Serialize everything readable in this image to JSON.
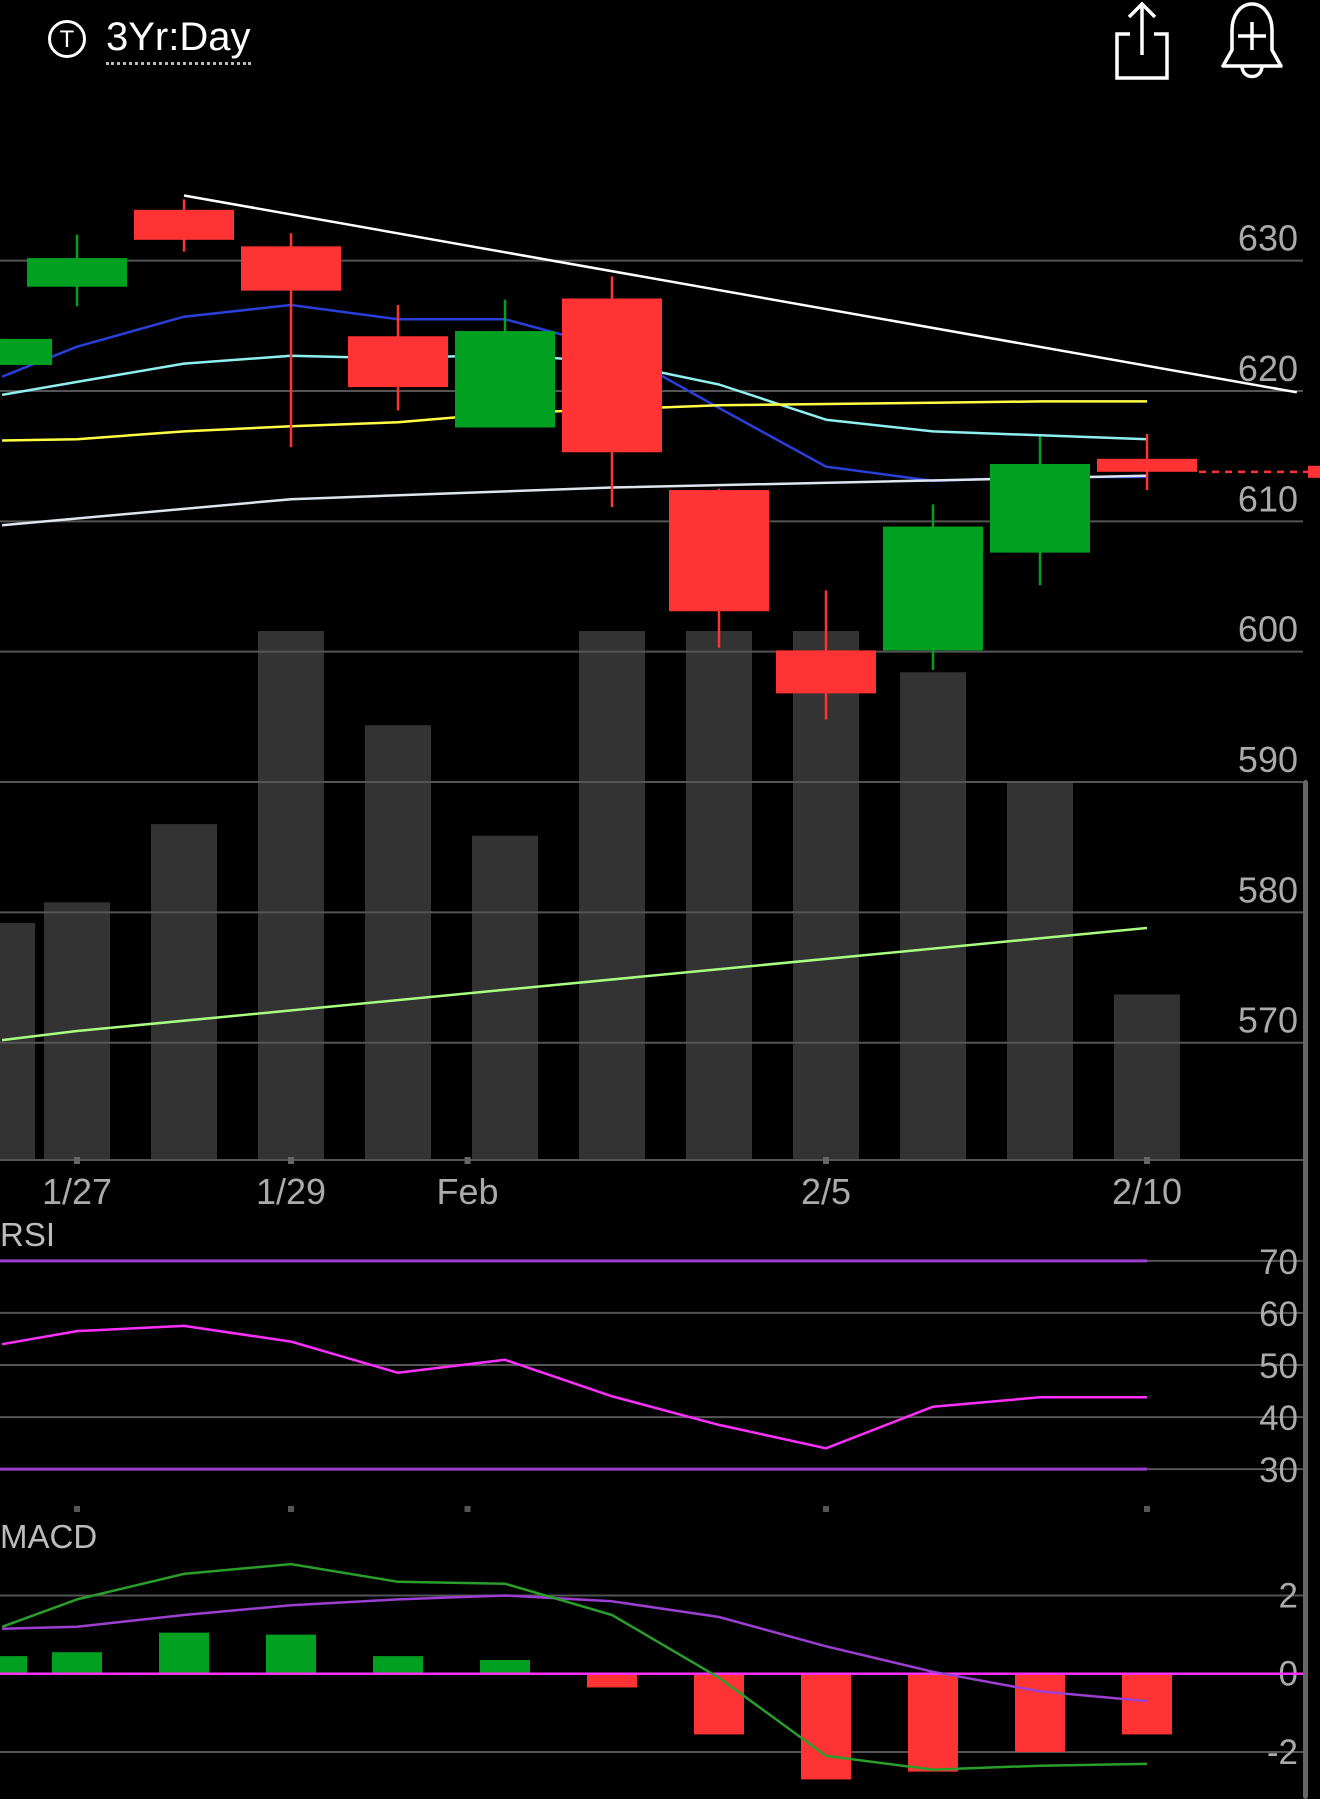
{
  "header": {
    "ticker_badge": "T",
    "range": "3Yr:Day",
    "share_icon": "share-icon",
    "alert_icon": "add-alert-bell-icon"
  },
  "colors": {
    "up": "#00a020",
    "down": "#ff3333",
    "bg": "#000000",
    "grid": "#555555",
    "ma_blue": "#2a3fd8",
    "ma_cyan": "#8ff0f0",
    "ma_yellow": "#ffff44",
    "ma_white": "#dde6f0",
    "ma_green": "#a8ff80",
    "rsi": "#ff30ff",
    "rsi_bounds": "#9a3fd0",
    "macd": "#2a9d2a",
    "signal": "#9a3fd0",
    "volume": "#333333",
    "trendline": "#ffffff"
  },
  "chart_data": [
    {
      "type": "candlestick",
      "ylim": [
        561,
        650
      ],
      "yticks": [
        570,
        580,
        590,
        600,
        610,
        620,
        630
      ],
      "x_labels": [
        {
          "index": 0,
          "text": "1/27"
        },
        {
          "index": 2,
          "text": "1/29"
        },
        {
          "index": 3.65,
          "text": "Feb"
        },
        {
          "index": 7,
          "text": "2/5"
        },
        {
          "index": 10,
          "text": "2/10"
        }
      ],
      "candles": [
        {
          "i": -0.7,
          "open": 622,
          "close": 624,
          "high": 624,
          "low": 622
        },
        {
          "i": 0,
          "open": 628,
          "close": 630.2,
          "high": 632,
          "low": 626.5
        },
        {
          "i": 1,
          "open": 633.9,
          "close": 631.6,
          "high": 634.7,
          "low": 630.7
        },
        {
          "i": 2,
          "open": 631.1,
          "close": 627.7,
          "high": 632.1,
          "low": 615.7
        },
        {
          "i": 3,
          "open": 624.2,
          "close": 620.3,
          "high": 626.6,
          "low": 618.5
        },
        {
          "i": 4,
          "open": 617.2,
          "close": 624.6,
          "high": 627,
          "low": 617.2
        },
        {
          "i": 5,
          "open": 627.1,
          "close": 615.3,
          "high": 628.8,
          "low": 611.1
        },
        {
          "i": 6,
          "open": 612.4,
          "close": 603.1,
          "high": 612.5,
          "low": 600.3
        },
        {
          "i": 7,
          "open": 600.1,
          "close": 596.8,
          "high": 604.7,
          "low": 594.8
        },
        {
          "i": 8,
          "open": 600.1,
          "close": 609.6,
          "high": 611.3,
          "low": 598.6
        },
        {
          "i": 9,
          "open": 607.6,
          "close": 614.4,
          "high": 616.5,
          "low": 605.1
        },
        {
          "i": 10,
          "open": 614.8,
          "close": 613.8,
          "high": 616.7,
          "low": 612.4
        }
      ],
      "last_price": 613.8,
      "volume": [
        {
          "i": -0.7,
          "h": 0.448
        },
        {
          "i": 0,
          "h": 0.487
        },
        {
          "i": 1,
          "h": 0.635
        },
        {
          "i": 2,
          "h": 1.0
        },
        {
          "i": 3,
          "h": 0.822
        },
        {
          "i": 4,
          "h": 0.613
        },
        {
          "i": 5,
          "h": 1.0
        },
        {
          "i": 6,
          "h": 1.0
        },
        {
          "i": 7,
          "h": 1.0
        },
        {
          "i": 8,
          "h": 0.922
        },
        {
          "i": 9,
          "h": 0.713
        },
        {
          "i": 10,
          "h": 0.313
        }
      ],
      "series": [
        {
          "color_key": "ma_blue",
          "values": [
            [
              -0.7,
              621.1
            ],
            [
              0,
              623.4
            ],
            [
              1,
              625.7
            ],
            [
              2,
              626.6
            ],
            [
              3,
              625.5
            ],
            [
              4,
              625.5
            ],
            [
              5,
              623.3
            ],
            [
              6,
              618.7
            ],
            [
              7,
              614.2
            ],
            [
              8,
              613.1
            ],
            [
              9,
              613.4
            ],
            [
              10,
              613.4
            ]
          ]
        },
        {
          "color_key": "ma_cyan",
          "values": [
            [
              -0.7,
              619.7
            ],
            [
              0,
              620.7
            ],
            [
              1,
              622.1
            ],
            [
              2,
              622.7
            ],
            [
              3,
              622.5
            ],
            [
              4,
              622.8
            ],
            [
              5,
              622.2
            ],
            [
              6,
              620.5
            ],
            [
              7,
              617.8
            ],
            [
              8,
              616.9
            ],
            [
              9,
              616.6
            ],
            [
              10,
              616.3
            ]
          ]
        },
        {
          "color_key": "ma_yellow",
          "values": [
            [
              -0.7,
              616.2
            ],
            [
              0,
              616.3
            ],
            [
              1,
              616.9
            ],
            [
              2,
              617.3
            ],
            [
              3,
              617.6
            ],
            [
              4,
              618.3
            ],
            [
              5,
              618.6
            ],
            [
              6,
              618.9
            ],
            [
              7,
              619.0
            ],
            [
              8,
              619.1
            ],
            [
              9,
              619.2
            ],
            [
              10,
              619.2
            ]
          ]
        },
        {
          "color_key": "ma_white",
          "values": [
            [
              -0.7,
              609.7
            ],
            [
              2,
              611.7
            ],
            [
              5,
              612.6
            ],
            [
              10,
              613.5
            ]
          ]
        },
        {
          "color_key": "ma_green",
          "values": [
            [
              -0.7,
              570.2
            ],
            [
              0,
              570.9
            ],
            [
              10,
              578.8
            ]
          ]
        },
        {
          "color_key": "trendline",
          "values": [
            [
              1,
              635.0
            ],
            [
              11.4,
              619.9
            ]
          ]
        }
      ]
    },
    {
      "type": "line",
      "title": "RSI",
      "ylim": [
        26,
        74
      ],
      "yticks": [
        30,
        40,
        50,
        60,
        70
      ],
      "bounds": [
        30,
        70
      ],
      "series": [
        {
          "values": [
            [
              -0.7,
              54
            ],
            [
              0,
              56.5
            ],
            [
              1,
              57.5
            ],
            [
              2,
              54.5
            ],
            [
              3,
              48.5
            ],
            [
              4,
              51
            ],
            [
              5,
              44
            ],
            [
              6,
              38.5
            ],
            [
              7,
              34
            ],
            [
              8,
              42
            ],
            [
              9,
              43.8
            ],
            [
              10,
              43.8
            ]
          ]
        }
      ]
    },
    {
      "type": "bar",
      "title": "MACD",
      "ylim": [
        -3.2,
        3.8
      ],
      "yticks": [
        -2,
        0,
        2
      ],
      "histogram": [
        [
          -0.7,
          0.45
        ],
        [
          0,
          0.55
        ],
        [
          1,
          1.05
        ],
        [
          2,
          1.0
        ],
        [
          3,
          0.45
        ],
        [
          4,
          0.35
        ],
        [
          5,
          -0.35
        ],
        [
          6,
          -1.55
        ],
        [
          7,
          -2.7
        ],
        [
          8,
          -2.5
        ],
        [
          9,
          -2.0
        ],
        [
          10,
          -1.55
        ]
      ],
      "macd": [
        [
          -0.7,
          1.2
        ],
        [
          0,
          1.9
        ],
        [
          1,
          2.55
        ],
        [
          2,
          2.8
        ],
        [
          3,
          2.35
        ],
        [
          4,
          2.3
        ],
        [
          5,
          1.5
        ],
        [
          6,
          -0.1
        ],
        [
          7,
          -2.1
        ],
        [
          8,
          -2.45
        ],
        [
          9,
          -2.35
        ],
        [
          10,
          -2.3
        ]
      ],
      "signal": [
        [
          -0.7,
          1.15
        ],
        [
          0,
          1.2
        ],
        [
          1,
          1.5
        ],
        [
          2,
          1.75
        ],
        [
          3,
          1.9
        ],
        [
          4,
          2.0
        ],
        [
          5,
          1.85
        ],
        [
          6,
          1.45
        ],
        [
          7,
          0.7
        ],
        [
          8,
          0.05
        ],
        [
          9,
          -0.45
        ],
        [
          10,
          -0.7
        ]
      ]
    }
  ]
}
